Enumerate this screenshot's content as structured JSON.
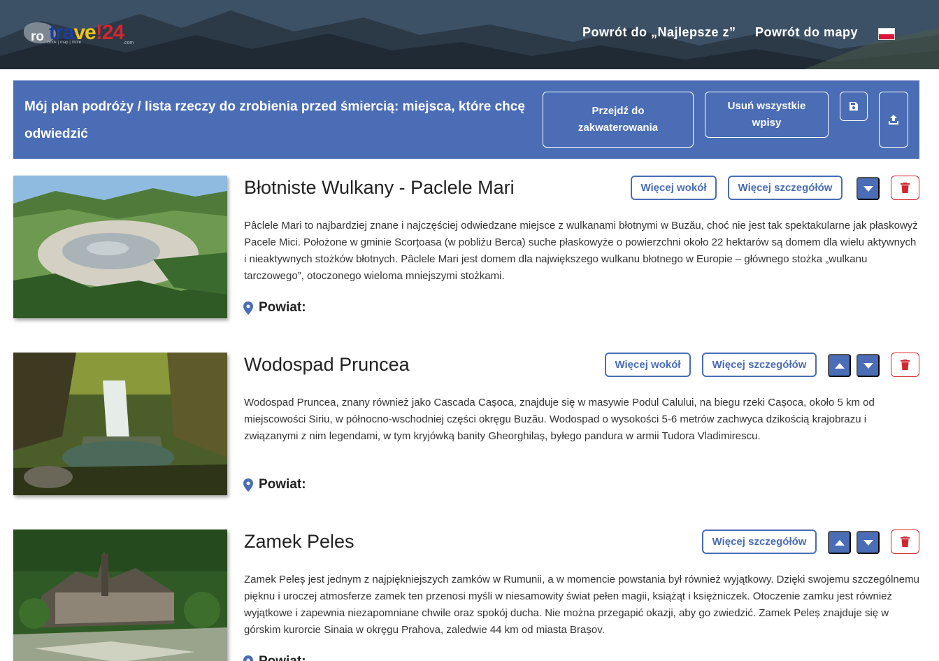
{
  "header": {
    "logo": {
      "ro": "ro",
      "travel_1": "tra",
      "travel_2": "ve",
      "travel_3": "!24",
      "tagline": "book | map | more",
      "com": ".com"
    },
    "nav": [
      "Powrót do „Najlepsze z”",
      "Powrót do mapy"
    ],
    "language_flag": "flag-poland-icon",
    "colors": {
      "brand_blue": "#4a6db5",
      "danger_red": "#d3262e"
    }
  },
  "plan": {
    "title": "Mój plan podróży / lista rzeczy do zrobienia przed śmiercią: miejsca, które chcę odwiedzić",
    "go_to_accommodation": "Przejdź do zakwaterowania",
    "delete_all": "Usuń wszystkie wpisy",
    "save_icon": "save-icon",
    "upload_icon": "upload-icon"
  },
  "entries": [
    {
      "title": "Błotniste Wulkany - Paclele Mari",
      "description": "Pâclele Mari to najbardziej znane i najczęściej odwiedzane miejsce z wulkanami błotnymi w Buzău, choć nie jest tak spektakularne jak płaskowyż Pacele Mici. Położone w gminie Scorțoasa (w pobliżu Berca) suche płaskowyże o powierzchni około 22 hektarów są domem dla wielu aktywnych i nieaktywnych stożków błotnych. Pâclele Mari jest domem dla największego wulkanu błotnego w Europie – głównego stożka „wulkanu tarczowego”, otoczonego wieloma mniejszymi stożkami.",
      "county_label": "Powiat:",
      "more_around": "Więcej wokół",
      "more_details": "Więcej szczegółów"
    },
    {
      "title": "Wodospad Pruncea",
      "description": "Wodospad Pruncea, znany również jako Cascada Cașoca, znajduje się w masywie Podul Calului, na biegu rzeki Cașoca, około 5 km od miejscowości Siriu, w północno-wschodniej części okręgu Buzău. Wodospad o wysokości 5-6 metrów zachwyca dzikością krajobrazu i związanymi z nim legendami, w tym kryjówką banity Gheorghilaș, byłego pandura w armii Tudora Vladimirescu.",
      "county_label": "Powiat:",
      "more_around": "Więcej wokół",
      "more_details": "Więcej szczegółów"
    },
    {
      "title": "Zamek Peles",
      "description": "Zamek Peleș jest jednym z najpiękniejszych zamków w Rumunii, a w momencie powstania był również wyjątkowy. Dzięki swojemu szczególnemu pięknu i uroczej atmosferze zamek ten przenosi myśli w niesamowity świat pełen magii, książąt i księżniczek. Otoczenie zamku jest również wyjątkowe i zapewnia niezapomniane chwile oraz spokój ducha. Nie można przegapić okazji, aby go zwiedzić. Zamek Peleș znajduje się w górskim kurorcie Sinaia w okręgu Prahova, zaledwie 44 km od miasta Brașov.",
      "county_label": "Powiat:",
      "more_details": "Więcej szczegółów"
    }
  ]
}
